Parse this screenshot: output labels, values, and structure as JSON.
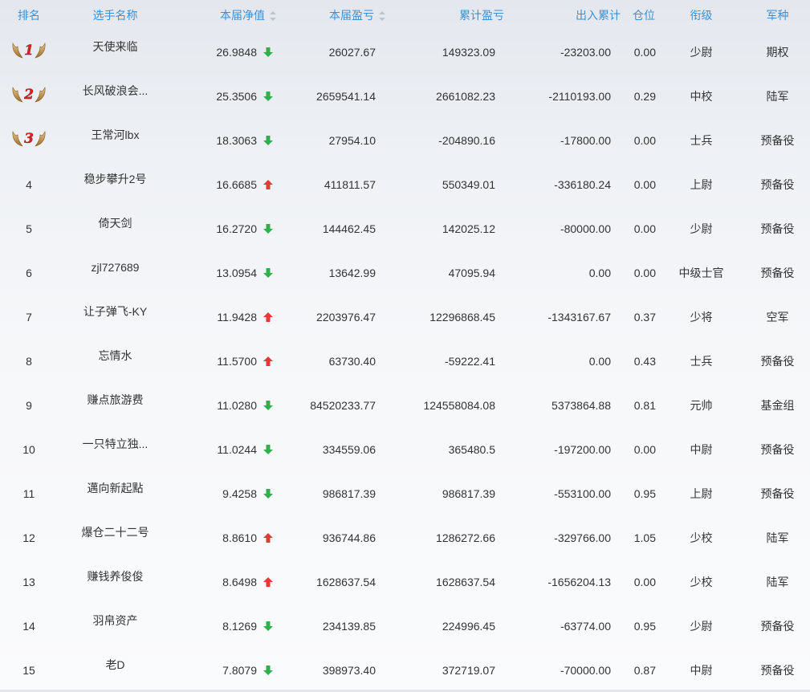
{
  "headers": {
    "rank": "排名",
    "name": "选手名称",
    "nav": "本届净值",
    "session_pnl": "本届盈亏",
    "total_pnl": "累计盈亏",
    "inout": "出入累计",
    "position": "仓位",
    "title": "衔级",
    "branch": "军种"
  },
  "colors": {
    "up": "#e53935",
    "down": "#2eb14a",
    "header": "#3d8fd6"
  },
  "rows": [
    {
      "rank": "1",
      "name": "天使来临",
      "nav": "26.9848",
      "trend": "down",
      "session_pnl": "26027.67",
      "total_pnl": "149323.09",
      "inout": "-23203.00",
      "position": "0.00",
      "title": "少尉",
      "branch": "期权"
    },
    {
      "rank": "2",
      "name": "长风破浪会...",
      "nav": "25.3506",
      "trend": "down",
      "session_pnl": "2659541.14",
      "total_pnl": "2661082.23",
      "inout": "-2110193.00",
      "position": "0.29",
      "title": "中校",
      "branch": "陆军"
    },
    {
      "rank": "3",
      "name": "王常河lbx",
      "nav": "18.3063",
      "trend": "down",
      "session_pnl": "27954.10",
      "total_pnl": "-204890.16",
      "inout": "-17800.00",
      "position": "0.00",
      "title": "士兵",
      "branch": "预备役"
    },
    {
      "rank": "4",
      "name": "稳步攀升2号",
      "nav": "16.6685",
      "trend": "up",
      "session_pnl": "411811.57",
      "total_pnl": "550349.01",
      "inout": "-336180.24",
      "position": "0.00",
      "title": "上尉",
      "branch": "预备役"
    },
    {
      "rank": "5",
      "name": "倚天剑",
      "nav": "16.2720",
      "trend": "down",
      "session_pnl": "144462.45",
      "total_pnl": "142025.12",
      "inout": "-80000.00",
      "position": "0.00",
      "title": "少尉",
      "branch": "预备役"
    },
    {
      "rank": "6",
      "name": "zjl727689",
      "nav": "13.0954",
      "trend": "down",
      "session_pnl": "13642.99",
      "total_pnl": "47095.94",
      "inout": "0.00",
      "position": "0.00",
      "title": "中级士官",
      "branch": "预备役"
    },
    {
      "rank": "7",
      "name": "让子弹飞-KY",
      "nav": "11.9428",
      "trend": "up",
      "session_pnl": "2203976.47",
      "total_pnl": "12296868.45",
      "inout": "-1343167.67",
      "position": "0.37",
      "title": "少将",
      "branch": "空军"
    },
    {
      "rank": "8",
      "name": "忘情水",
      "nav": "11.5700",
      "trend": "up",
      "session_pnl": "63730.40",
      "total_pnl": "-59222.41",
      "inout": "0.00",
      "position": "0.43",
      "title": "士兵",
      "branch": "预备役"
    },
    {
      "rank": "9",
      "name": "赚点旅游费",
      "nav": "11.0280",
      "trend": "down",
      "session_pnl": "84520233.77",
      "total_pnl": "124558084.08",
      "inout": "5373864.88",
      "position": "0.81",
      "title": "元帅",
      "branch": "基金组"
    },
    {
      "rank": "10",
      "name": "一只特立独...",
      "nav": "11.0244",
      "trend": "down",
      "session_pnl": "334559.06",
      "total_pnl": "365480.5",
      "inout": "-197200.00",
      "position": "0.00",
      "title": "中尉",
      "branch": "预备役"
    },
    {
      "rank": "11",
      "name": "邁向新起點",
      "nav": "9.4258",
      "trend": "down",
      "session_pnl": "986817.39",
      "total_pnl": "986817.39",
      "inout": "-553100.00",
      "position": "0.95",
      "title": "上尉",
      "branch": "预备役"
    },
    {
      "rank": "12",
      "name": "爆仓二十二号",
      "nav": "8.8610",
      "trend": "up",
      "session_pnl": "936744.86",
      "total_pnl": "1286272.66",
      "inout": "-329766.00",
      "position": "1.05",
      "title": "少校",
      "branch": "陆军"
    },
    {
      "rank": "13",
      "name": "赚钱养俊俊",
      "nav": "8.6498",
      "trend": "up",
      "session_pnl": "1628637.54",
      "total_pnl": "1628637.54",
      "inout": "-1656204.13",
      "position": "0.00",
      "title": "少校",
      "branch": "陆军"
    },
    {
      "rank": "14",
      "name": "羽帛资产",
      "nav": "8.1269",
      "trend": "down",
      "session_pnl": "234139.85",
      "total_pnl": "224996.45",
      "inout": "-63774.00",
      "position": "0.95",
      "title": "少尉",
      "branch": "预备役"
    },
    {
      "rank": "15",
      "name": "老D",
      "nav": "7.8079",
      "trend": "down",
      "session_pnl": "398973.40",
      "total_pnl": "372719.07",
      "inout": "-70000.00",
      "position": "0.87",
      "title": "中尉",
      "branch": "预备役"
    }
  ]
}
